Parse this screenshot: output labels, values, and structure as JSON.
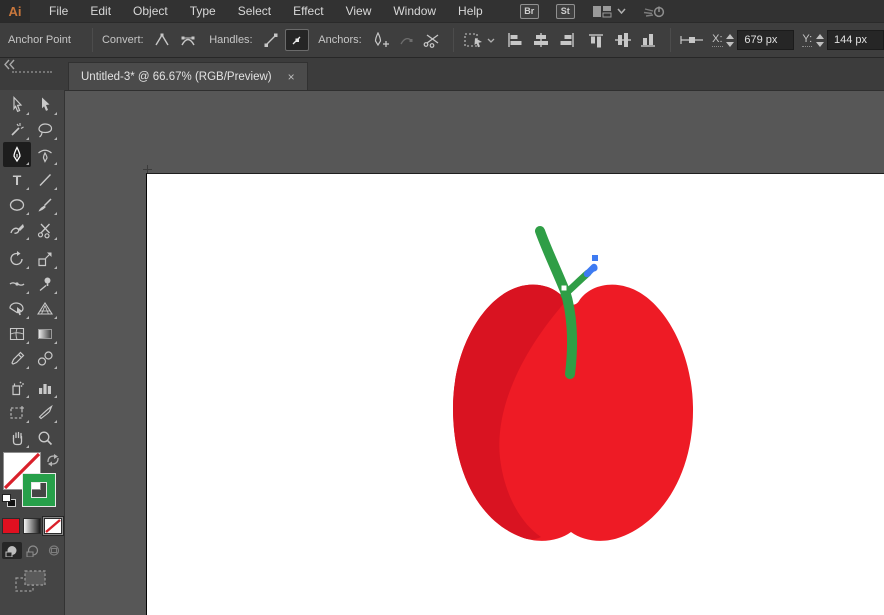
{
  "app": {
    "name": "Adobe Illustrator"
  },
  "menu_bar": {
    "logo": "Ai",
    "items": [
      "File",
      "Edit",
      "Object",
      "Type",
      "Select",
      "Effect",
      "View",
      "Window",
      "Help"
    ],
    "bridge_label": "Br",
    "stock_label": "St"
  },
  "control_bar": {
    "context_label": "Anchor Point",
    "convert_label": "Convert:",
    "handles_label": "Handles:",
    "anchors_label": "Anchors:",
    "x_label": "X:",
    "x_value": "679 px",
    "y_label": "Y:",
    "y_value": "144 px"
  },
  "document_tab": {
    "title": "Untitled-3* @ 66.67% (RGB/Preview)",
    "close_glyph": "×"
  },
  "toolbar": {
    "type_glyph": "T",
    "tools": [
      "selection-tool",
      "direct-selection-tool",
      "magic-wand-tool",
      "lasso-tool",
      "pen-tool",
      "curvature-tool",
      "type-tool",
      "line-segment-tool",
      "ellipse-tool",
      "paintbrush-tool",
      "shaper-tool",
      "scissors-tool",
      "rotate-tool",
      "scale-tool",
      "width-tool",
      "puppet-warp-tool",
      "shape-builder-tool",
      "perspective-grid-tool",
      "mesh-tool",
      "gradient-tool",
      "eyedropper-tool",
      "blend-tool",
      "symbol-sprayer-tool",
      "column-graph-tool",
      "artboard-tool",
      "slice-tool",
      "hand-tool",
      "zoom-tool"
    ],
    "selected_tool": "pen-tool"
  },
  "swatches": {
    "fill": "none",
    "stroke_color": "#27A04A"
  },
  "artwork": {
    "apple_body_color": "#EE1B25",
    "apple_shade_color": "#D91321",
    "stem_color": "#2F9E46",
    "selection_blue": "#3E7BF2",
    "anchor_white": "#FFFFFF"
  },
  "colors": {
    "ui_dark": "#323232",
    "ui_mid": "#3E3E3E",
    "panel": "#454545",
    "canvas": "#575757",
    "accent_red": "#E01020"
  }
}
